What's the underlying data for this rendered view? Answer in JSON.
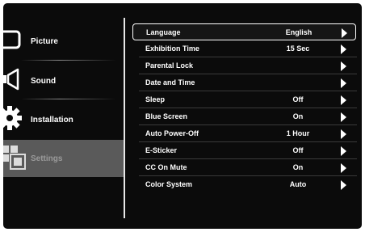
{
  "sidebar": {
    "items": [
      {
        "label": "Picture",
        "icon": "picture-icon"
      },
      {
        "label": "Sound",
        "icon": "speaker-icon"
      },
      {
        "label": "Installation",
        "icon": "gear-icon"
      },
      {
        "label": "Settings",
        "icon": "settings-icon"
      }
    ],
    "active_index": 3
  },
  "menu": {
    "rows": [
      {
        "name": "Language",
        "value": "English"
      },
      {
        "name": "Exhibition Time",
        "value": "15 Sec"
      },
      {
        "name": "Parental Lock",
        "value": ""
      },
      {
        "name": "Date and Time",
        "value": ""
      },
      {
        "name": "Sleep",
        "value": "Off"
      },
      {
        "name": "Blue Screen",
        "value": "On"
      },
      {
        "name": "Auto Power-Off",
        "value": "1 Hour"
      },
      {
        "name": "E-Sticker",
        "value": "Off"
      },
      {
        "name": "CC On Mute",
        "value": "On"
      },
      {
        "name": "Color System",
        "value": "Auto"
      }
    ],
    "selected_index": 0
  },
  "colors": {
    "background": "#0b0b0b",
    "active_sidebar": "#5a5a5a",
    "text": "#ffffff"
  }
}
